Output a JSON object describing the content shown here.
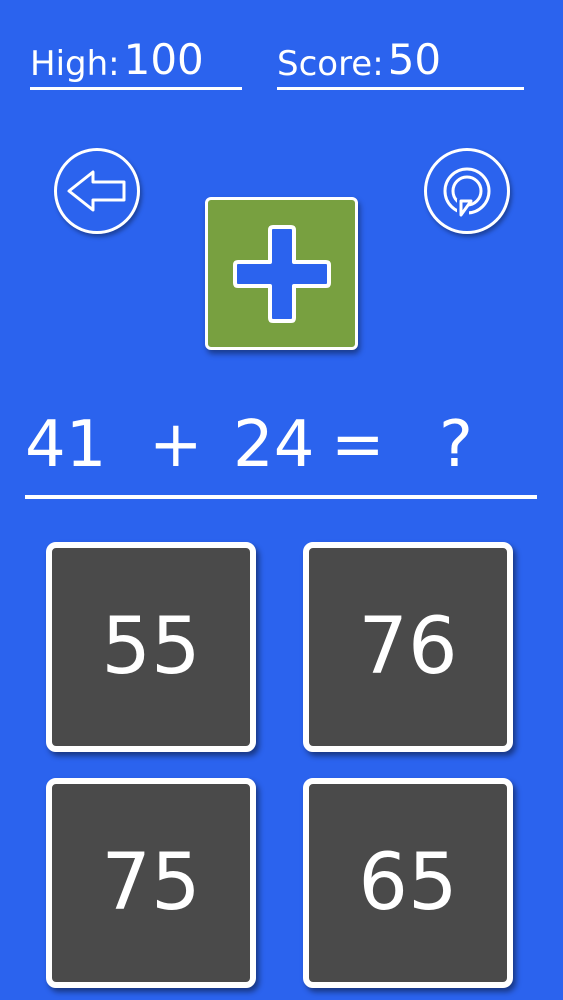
{
  "stats": {
    "high_label": "High:",
    "high_value": "100",
    "score_label": "Score:",
    "score_value": "50"
  },
  "controls": {
    "back_icon": "arrow-left-icon",
    "restart_icon": "restart-icon"
  },
  "operation": {
    "icon": "plus-icon",
    "color": "#78a040",
    "symbol_color": "#2b63ee"
  },
  "question": {
    "operand_a": "41",
    "operator": "+",
    "operand_b": "24",
    "equals": "=",
    "unknown": "?"
  },
  "answers": [
    "55",
    "76",
    "75",
    "65"
  ],
  "colors": {
    "background": "#2b63ee",
    "tile": "#4a4a4a",
    "text": "#ffffff"
  }
}
